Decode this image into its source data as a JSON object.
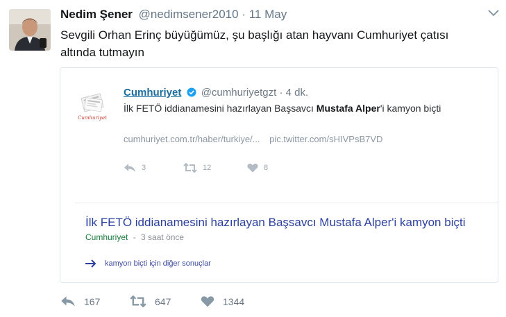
{
  "tweet": {
    "author_name": "Nedim Şener",
    "author_handle": "@nedimsener2010",
    "separator": "·",
    "timestamp": "11 May",
    "text": "Sevgili Orhan Erinç büyüğümüz, şu başlığı atan hayvanı Cumhuriyet çatısı altında tutmayın",
    "actions": {
      "replies": "167",
      "retweets": "647",
      "likes": "1344"
    }
  },
  "quoted": {
    "logo_text": "Cumhuriyet",
    "author_name": "Cumhuriyet",
    "author_handle": "@cumhuriyetgzt",
    "separator": "·",
    "timestamp": "4 dk.",
    "text_before": "İlk FETÖ iddianamesini hazırlayan Başsavcı ",
    "text_bold": "Mustafa Alper",
    "text_after": "'i kamyon biçti",
    "link_1": "cumhuriyet.com.tr/haber/turkiye/...",
    "link_2": "pic.twitter.com/sHIVPsB7VD",
    "actions": {
      "replies": "3",
      "retweets": "12",
      "likes": "8"
    }
  },
  "search": {
    "result_title": "İlk FETÖ iddianamesini hazırlayan Başsavcı Mustafa Alper'i kamyon biçti",
    "result_source": "Cumhuriyet",
    "result_separator": "-",
    "result_age": "3 saat önce",
    "more_results": "kamyon biçti için diğer sonuçlar"
  },
  "colors": {
    "link_blue": "#1b6e9e",
    "search_title": "#2a3f9e",
    "source_green": "#1a7d3a",
    "muted": "#657786"
  }
}
